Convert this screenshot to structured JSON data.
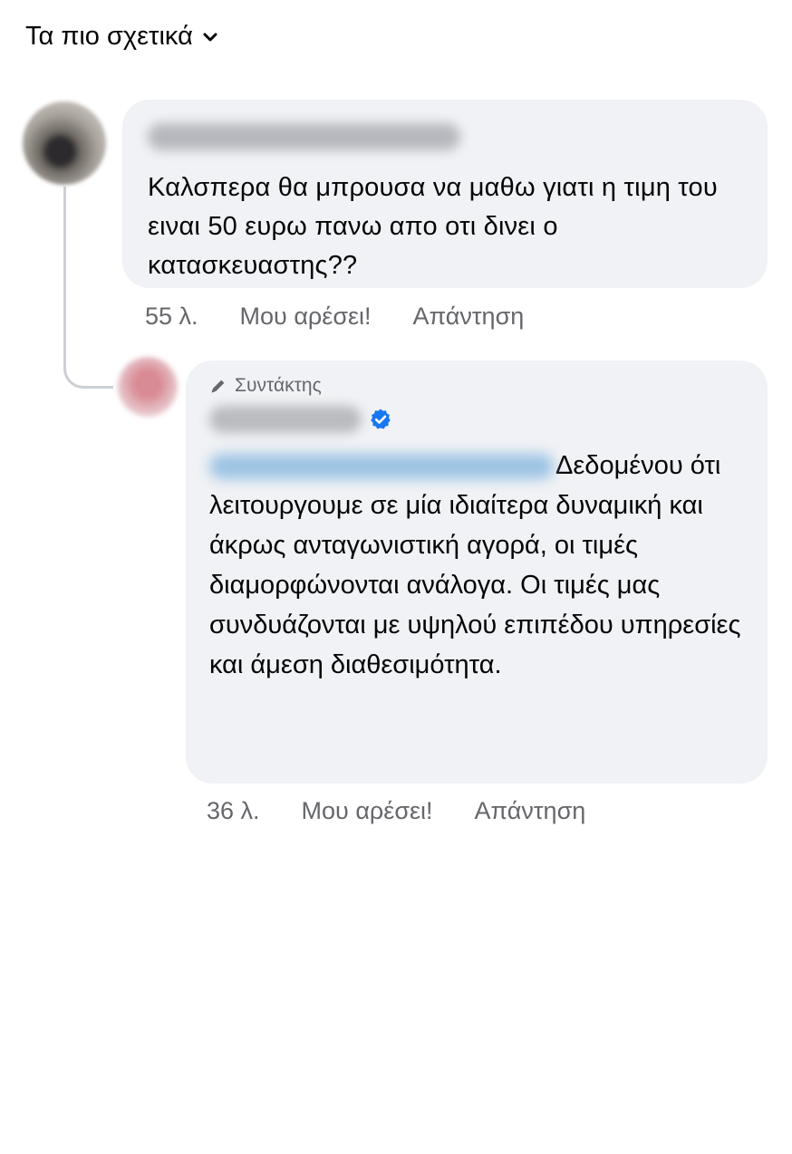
{
  "sort": {
    "label": "Τα πιο σχετικά",
    "icon": "chevron-down-icon"
  },
  "comments": [
    {
      "text": "Καλσπερα θα μπρουσα να μαθω γιατι η τιμη του ειναι 50 ευρω πανω απο οτι δινει ο κατασκευαστης??",
      "time": "55 λ.",
      "like_label": "Μου αρέσει!",
      "reply_label": "Απάντηση"
    },
    {
      "badge": "Συντάκτης",
      "verified_icon": "verified-badge-icon",
      "text": "Δεδομένου ότι λειτουργουμε σε μία ιδιαίτερα δυναμική και άκρως ανταγωνιστική αγορά, οι τιμές διαμορφώνονται ανάλογα. Οι τιμές μας συνδυάζονται  με υψηλού επιπέδου υπηρεσίες και άμεση διαθεσιμότητα.",
      "time": "36 λ.",
      "like_label": "Μου αρέσει!",
      "reply_label": "Απάντηση"
    }
  ],
  "colors": {
    "bubble": "#f0f2f5",
    "meta_text": "#65676b",
    "verified": "#1877f2"
  }
}
